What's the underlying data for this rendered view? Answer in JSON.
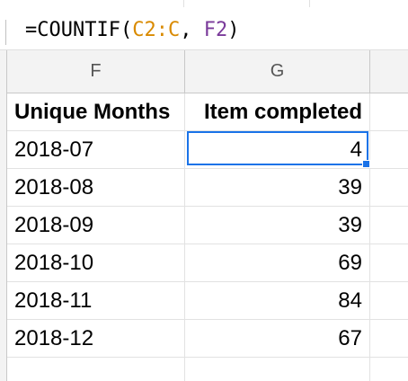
{
  "formula_bar": {
    "tokens": [
      {
        "text": "=COUNTIF(",
        "kind": "plain"
      },
      {
        "text": "C2:C",
        "kind": "range"
      },
      {
        "text": ", ",
        "kind": "plain"
      },
      {
        "text": "F2",
        "kind": "ref"
      },
      {
        "text": ")",
        "kind": "plain"
      }
    ]
  },
  "columns": {
    "f": "F",
    "g": "G"
  },
  "table": {
    "header": {
      "f": "Unique Months",
      "g": "Item completed"
    },
    "rows": [
      {
        "f": "2018-07",
        "g": "4"
      },
      {
        "f": "2018-08",
        "g": "39"
      },
      {
        "f": "2018-09",
        "g": "39"
      },
      {
        "f": "2018-10",
        "g": "69"
      },
      {
        "f": "2018-11",
        "g": "84"
      },
      {
        "f": "2018-12",
        "g": "67"
      }
    ]
  },
  "selection": {
    "cell": "G2"
  },
  "colors": {
    "selection": "#1a73e8",
    "range_token": "#d98a00",
    "ref_token": "#7a3a9a",
    "header_bg": "#f3f3f3"
  }
}
